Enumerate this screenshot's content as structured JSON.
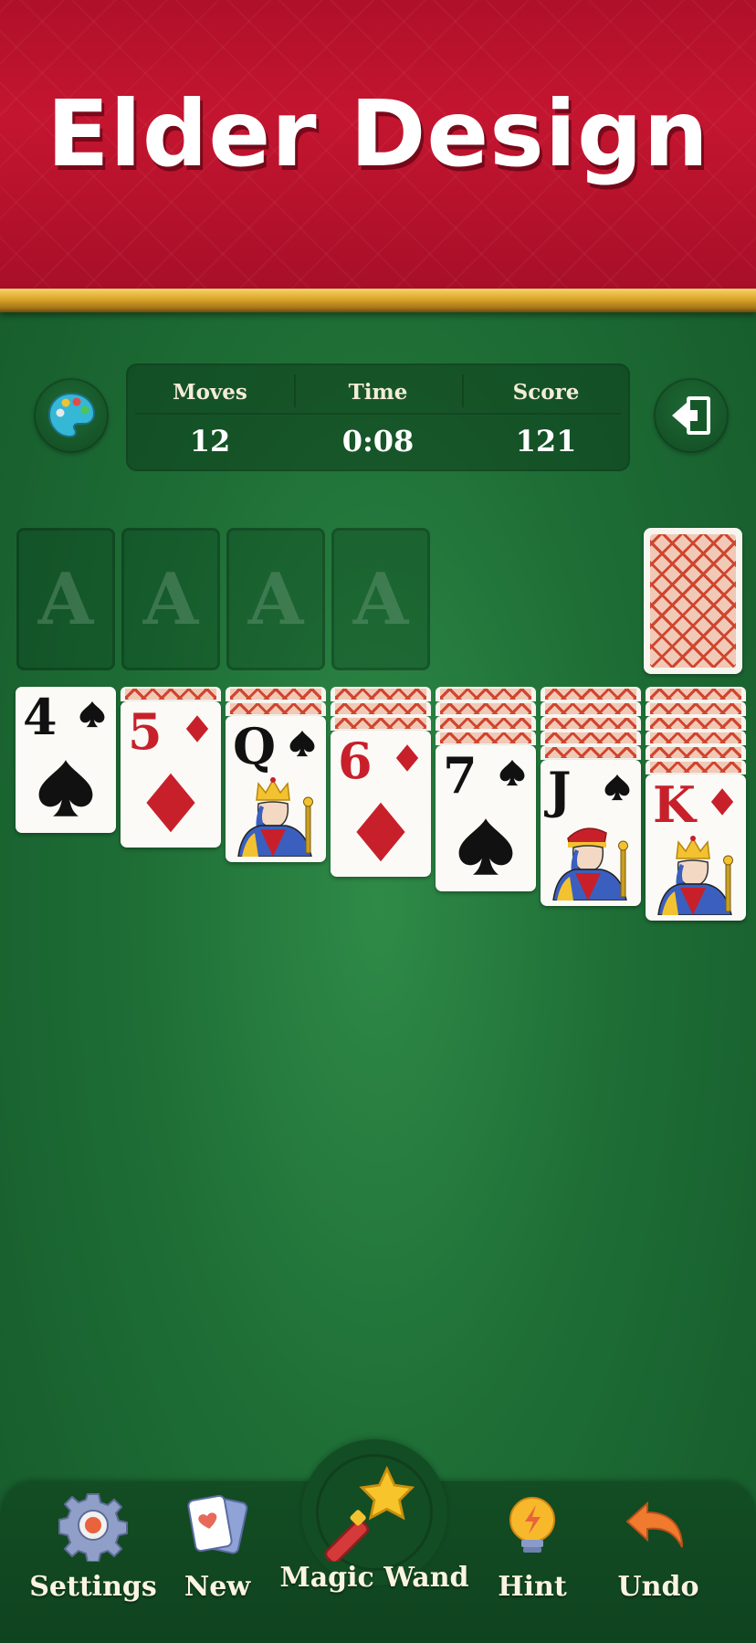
{
  "banner": {
    "title": "Elder Design"
  },
  "stats": {
    "moves_label": "Moves",
    "moves_value": "12",
    "time_label": "Time",
    "time_value": "0:08",
    "score_label": "Score",
    "score_value": "121"
  },
  "foundations": [
    "A",
    "A",
    "A",
    "A"
  ],
  "tableau": [
    {
      "hidden": 0,
      "rank": "4",
      "suit": "spade",
      "color": "black"
    },
    {
      "hidden": 1,
      "rank": "5",
      "suit": "diamond",
      "color": "red"
    },
    {
      "hidden": 2,
      "rank": "Q",
      "suit": "spade",
      "color": "black",
      "face": "queen"
    },
    {
      "hidden": 3,
      "rank": "6",
      "suit": "diamond",
      "color": "red"
    },
    {
      "hidden": 4,
      "rank": "7",
      "suit": "spade",
      "color": "black"
    },
    {
      "hidden": 5,
      "rank": "J",
      "suit": "spade",
      "color": "black",
      "face": "jack"
    },
    {
      "hidden": 6,
      "rank": "K",
      "suit": "diamond",
      "color": "red",
      "face": "king"
    }
  ],
  "toolbar": {
    "settings_label": "Settings",
    "new_label": "New",
    "magic_wand_label": "Magic Wand",
    "hint_label": "Hint",
    "undo_label": "Undo"
  },
  "colors": {
    "felt": "#1e6e36",
    "banner": "#c41530",
    "gold": "#d9a528",
    "red_suit": "#c8202b"
  }
}
